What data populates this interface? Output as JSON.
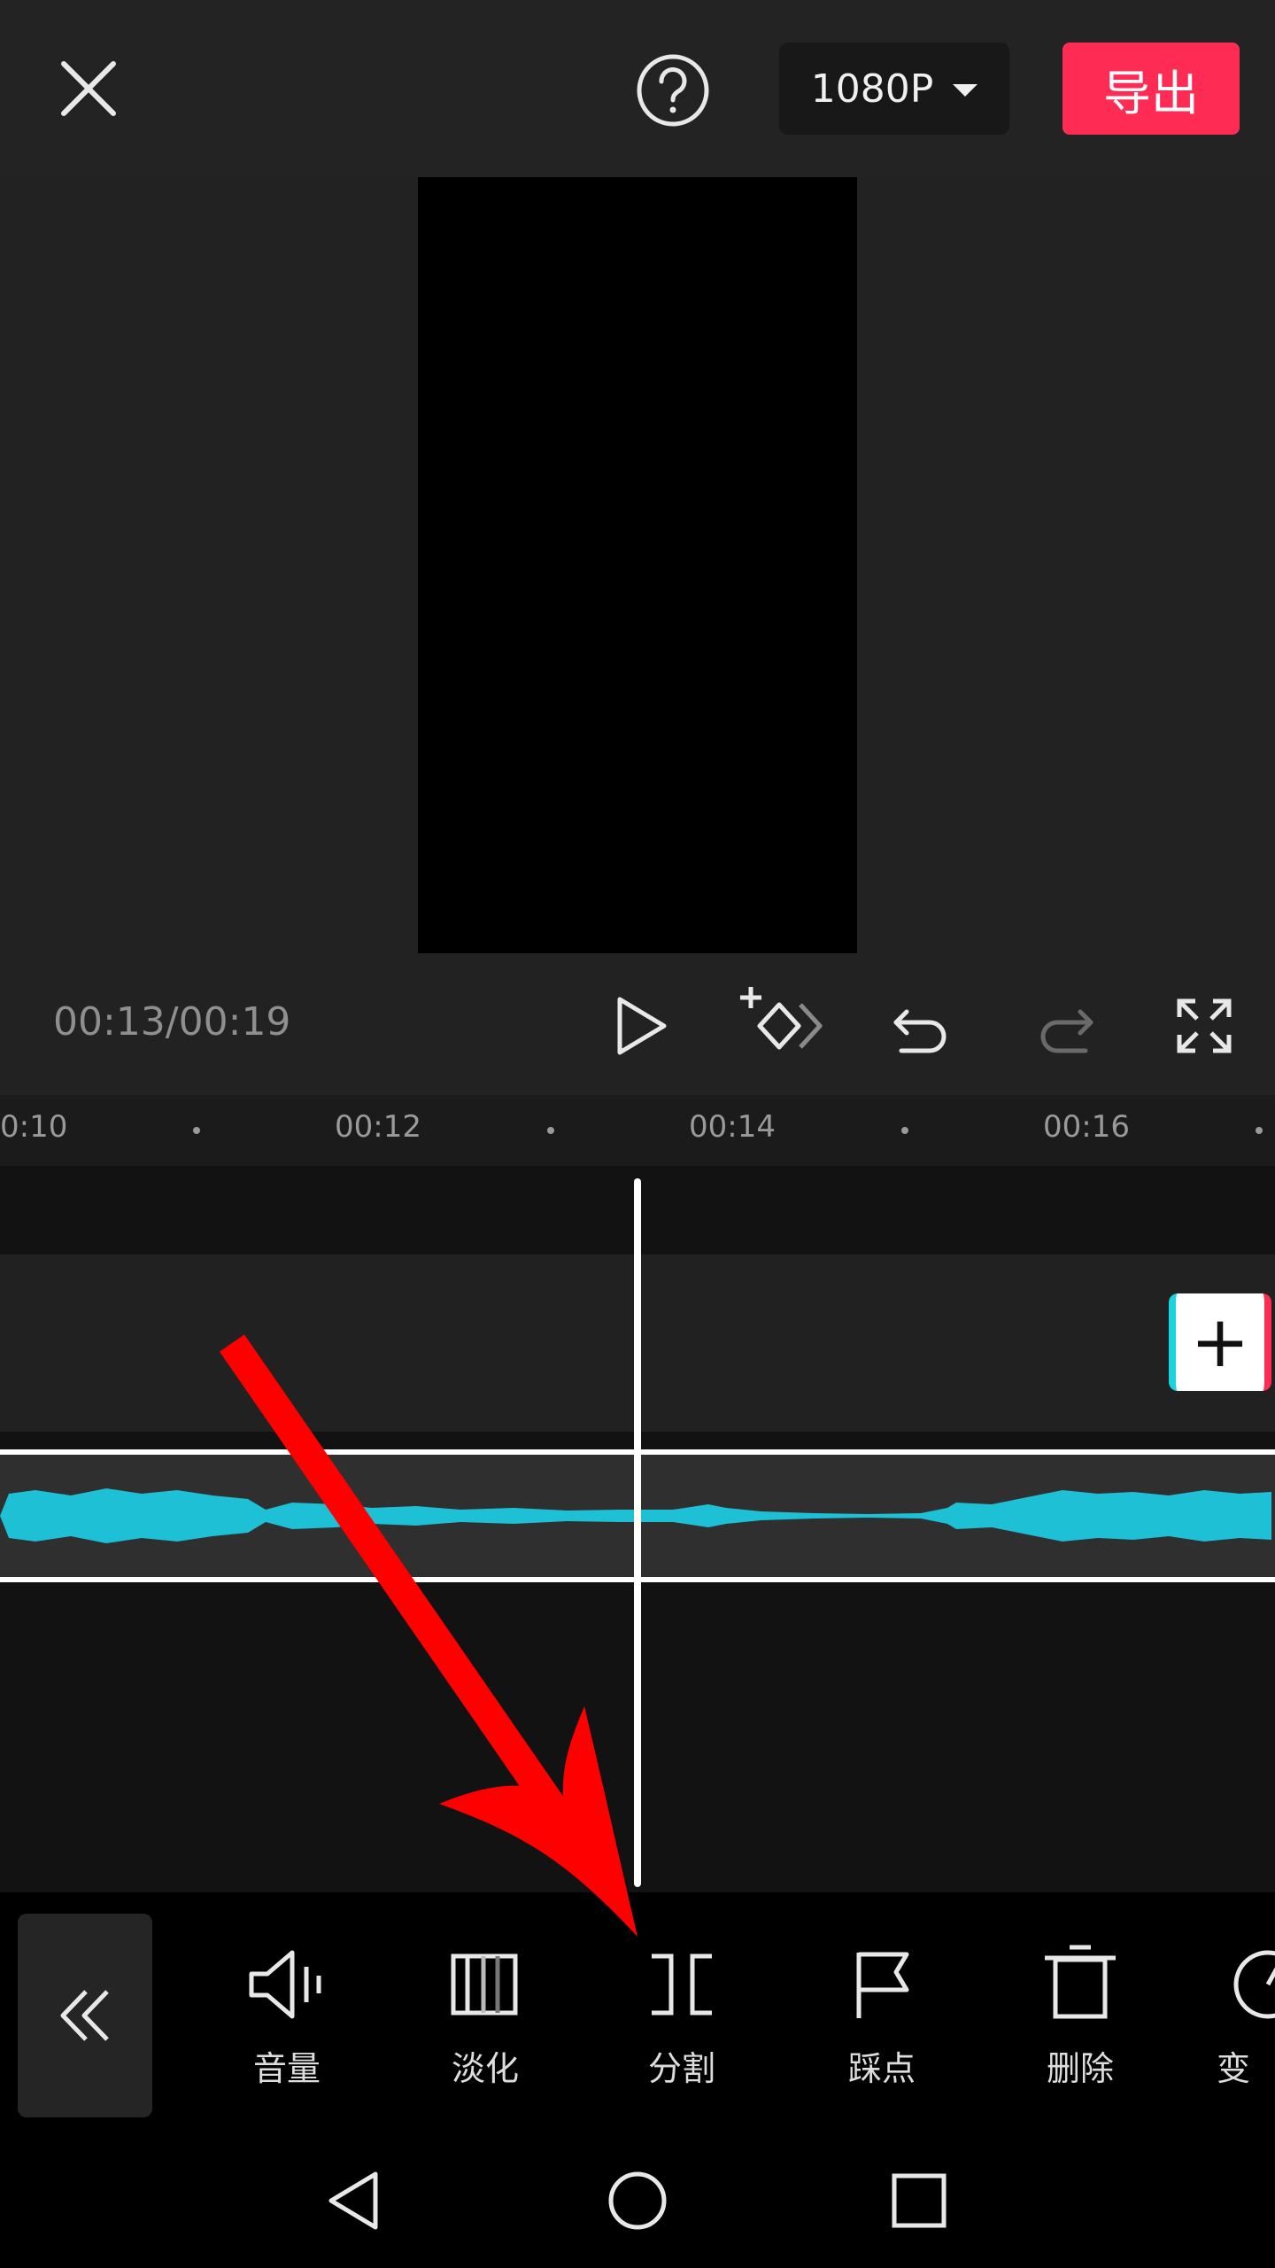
{
  "header": {
    "resolution": "1080P",
    "export_label": "导出"
  },
  "playbar": {
    "time": "00:13/00:19"
  },
  "ruler": {
    "labels": [
      "0:10",
      "00:12",
      "00:14",
      "00:16"
    ]
  },
  "toolbar": {
    "tools": [
      {
        "label": "音量",
        "icon": "volume-icon"
      },
      {
        "label": "淡化",
        "icon": "fade-icon"
      },
      {
        "label": "分割",
        "icon": "split-icon"
      },
      {
        "label": "踩点",
        "icon": "beat-flag-icon"
      },
      {
        "label": "删除",
        "icon": "delete-icon"
      },
      {
        "label": "变",
        "icon": "speed-icon"
      }
    ]
  },
  "colors": {
    "accent": "#fe2c55",
    "waveform": "#1ec0d6",
    "annotation_arrow": "#ff0000"
  }
}
